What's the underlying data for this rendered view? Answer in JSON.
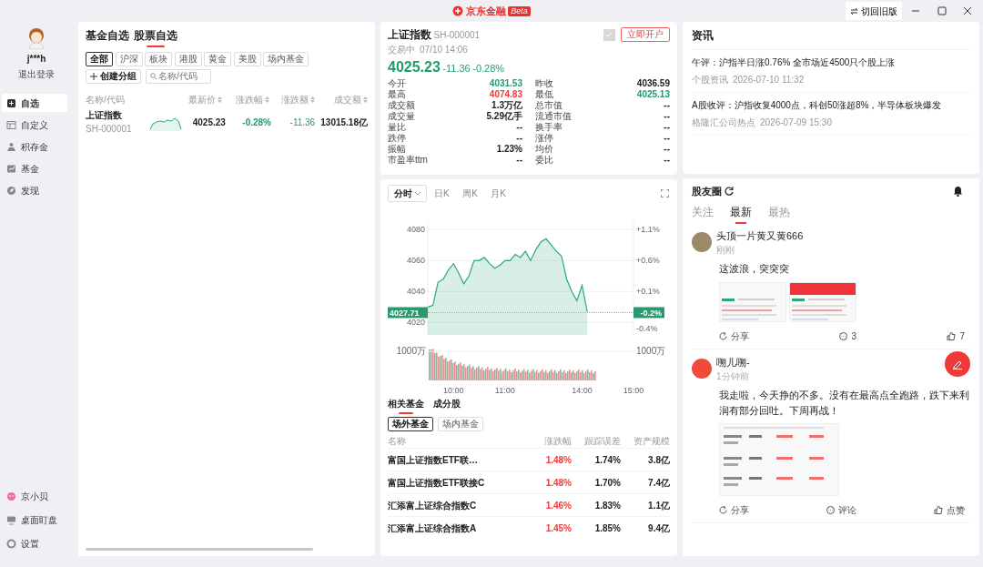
{
  "titlebar": {
    "logo_text": "京东金融",
    "badge": "Beta",
    "switch_button": "切回旧版"
  },
  "sidebar": {
    "user": {
      "name": "j***h",
      "logout": "退出登录"
    },
    "items": [
      {
        "label": "自选",
        "selected": true
      },
      {
        "label": "自定义",
        "selected": false
      },
      {
        "label": "积存金",
        "selected": false
      },
      {
        "label": "基金",
        "selected": false
      },
      {
        "label": "发现",
        "selected": false
      }
    ],
    "bottom_items": [
      {
        "label": "京小贝"
      },
      {
        "label": "桌面盯盘"
      },
      {
        "label": "设置"
      }
    ]
  },
  "watchlist": {
    "tabs": [
      {
        "label": "基金自选",
        "selected": false
      },
      {
        "label": "股票自选",
        "selected": true
      }
    ],
    "filters": [
      {
        "label": "全部",
        "selected": true
      },
      {
        "label": "沪深",
        "selected": false
      },
      {
        "label": "板块",
        "selected": false
      },
      {
        "label": "港股",
        "selected": false
      },
      {
        "label": "黄金",
        "selected": false
      },
      {
        "label": "美股",
        "selected": false
      },
      {
        "label": "场内基金",
        "selected": false
      }
    ],
    "create_group": "创建分组",
    "search": {
      "placeholder": "名称/代码"
    },
    "columns": [
      {
        "label": "名称/代码",
        "sortable": false
      },
      {
        "label": "最新价",
        "sortable": true
      },
      {
        "label": "涨跌幅",
        "sortable": true
      },
      {
        "label": "涨跌额",
        "sortable": true
      },
      {
        "label": "成交额",
        "sortable": true
      }
    ],
    "rows": [
      {
        "name": "上证指数",
        "code": "SH-000001",
        "price": "4025.23",
        "change_pct": "-0.28%",
        "change": "-11.36",
        "turnover": "13015.18亿",
        "color": "#1f9e6a"
      }
    ]
  },
  "quote": {
    "name": "上证指数",
    "code": "SH-000001",
    "status": "交易中",
    "time": "07/10 14:06",
    "price": "4025.23",
    "change": "-11.36",
    "change_pct": "-0.28%",
    "color": "#1f9e6a",
    "open_account": "立即开户",
    "stats": [
      {
        "label": "今开",
        "value": "4031.53",
        "color": "#1f9e6a"
      },
      {
        "label": "昨收",
        "value": "4036.59"
      },
      {
        "label": "最高",
        "value": "4074.83",
        "color": "#f03a3a"
      },
      {
        "label": "最低",
        "value": "4025.13",
        "color": "#1f9e6a"
      },
      {
        "label": "成交额",
        "value": "1.3万亿"
      },
      {
        "label": "总市值",
        "value": "--"
      },
      {
        "label": "成交量",
        "value": "5.29亿手"
      },
      {
        "label": "流通市值",
        "value": "--"
      },
      {
        "label": "量比",
        "value": "--"
      },
      {
        "label": "换手率",
        "value": "--"
      },
      {
        "label": "跌停",
        "value": "--"
      },
      {
        "label": "涨停",
        "value": "--"
      },
      {
        "label": "振幅",
        "value": "1.23%"
      },
      {
        "label": "均价",
        "value": "--"
      },
      {
        "label": "市盈率ttm",
        "value": "--"
      },
      {
        "label": "委比",
        "value": "--"
      }
    ]
  },
  "chart": {
    "tabs": [
      {
        "label": "分时",
        "selected": true,
        "has_menu": true
      },
      {
        "label": "日K",
        "selected": false,
        "has_menu": false
      },
      {
        "label": "周K",
        "selected": false,
        "has_menu": false
      },
      {
        "label": "月K",
        "selected": false,
        "has_menu": false
      }
    ],
    "right_axis_labels": [
      "+1.1%",
      "+0.6%",
      "+0.1%",
      "-0.4%"
    ],
    "price_tag": "4027.71",
    "percent_tag": "-0.2%",
    "volume_labels": [
      "1000万",
      "1000万"
    ],
    "chart_data": {
      "type": "area",
      "grid": true,
      "categories": [
        null,
        null,
        null,
        null,
        null,
        "10:00",
        null,
        null,
        null,
        null,
        null,
        null,
        null,
        null,
        null,
        "11:00",
        null,
        null,
        null,
        null,
        null,
        null,
        null,
        null,
        null,
        null,
        null,
        null,
        null,
        null,
        "14:00",
        null,
        null,
        null,
        null,
        null,
        null,
        null,
        null,
        null,
        "15:00"
      ],
      "series": [
        {
          "color": "#2aa876",
          "values": [
            4030,
            4031,
            4046,
            4048,
            4054,
            4058,
            4052,
            4045,
            4050,
            4060,
            4060,
            4062,
            4058,
            4055,
            4057,
            4060,
            4060,
            4064,
            4062,
            4066,
            4060,
            4067,
            4072,
            4074,
            4070,
            4066,
            4063,
            4048,
            4040,
            4034,
            4044,
            4027,
            null,
            null,
            null,
            null,
            null,
            null,
            null,
            null,
            null
          ]
        }
      ],
      "ylim": [
        4012,
        4086
      ],
      "yticks": [
        4020,
        4040,
        4060,
        4080
      ]
    }
  },
  "funds": {
    "tabs": [
      {
        "label": "相关基金",
        "selected": true
      },
      {
        "label": "成分股",
        "selected": false
      }
    ],
    "filters": [
      {
        "label": "场外基金",
        "selected": true
      },
      {
        "label": "场内基金",
        "selected": false
      }
    ],
    "columns": [
      "名称",
      "涨跌幅",
      "跟踪误差",
      "资产规模"
    ],
    "rows": [
      {
        "name": "富国上证指数ETF联…",
        "change_pct": "1.48%",
        "tracking_error": "1.74%",
        "size": "3.8亿"
      },
      {
        "name": "富国上证指数ETF联接C",
        "change_pct": "1.48%",
        "tracking_error": "1.70%",
        "size": "7.4亿"
      },
      {
        "name": "汇添富上证综合指数C",
        "change_pct": "1.46%",
        "tracking_error": "1.83%",
        "size": "1.1亿"
      },
      {
        "name": "汇添富上证综合指数A",
        "change_pct": "1.45%",
        "tracking_error": "1.85%",
        "size": "9.4亿"
      }
    ]
  },
  "news": {
    "title": "资讯",
    "items": [
      {
        "headline": "午评：沪指半日涨0.76% 全市场近4500只个股上涨",
        "source": "个股资讯",
        "time": "2026-07-10 11:32"
      },
      {
        "headline": "A股收评：沪指收复4000点，科创50涨超8%，半导体板块爆发",
        "source": "格隆汇公司热点",
        "time": "2026-07-09 15:30"
      }
    ]
  },
  "community": {
    "title": "股友圈",
    "tabs": [
      {
        "label": "关注",
        "selected": false
      },
      {
        "label": "最新",
        "selected": true
      },
      {
        "label": "最热",
        "selected": false
      }
    ],
    "posts": [
      {
        "author": "头顶一片黄又黄666",
        "time": "刚刚",
        "text": "这波浪，突突突",
        "color": "#9a8a6a",
        "images": [
          {
            "kind": "quote"
          },
          {
            "kind": "quote-red"
          }
        ],
        "share": "分享",
        "comment": "3",
        "like": "7"
      },
      {
        "author": "嗍儿嗍-",
        "time": "1分钟前",
        "text": "我走啦，今天挣的不多。没有在最高点全跑路，跌下来利润有部分回吐。下周再战！",
        "color": "#f04a3a",
        "images": [
          {
            "kind": "table"
          }
        ],
        "share": "分享",
        "comment": "评论",
        "like": "点赞"
      }
    ]
  }
}
